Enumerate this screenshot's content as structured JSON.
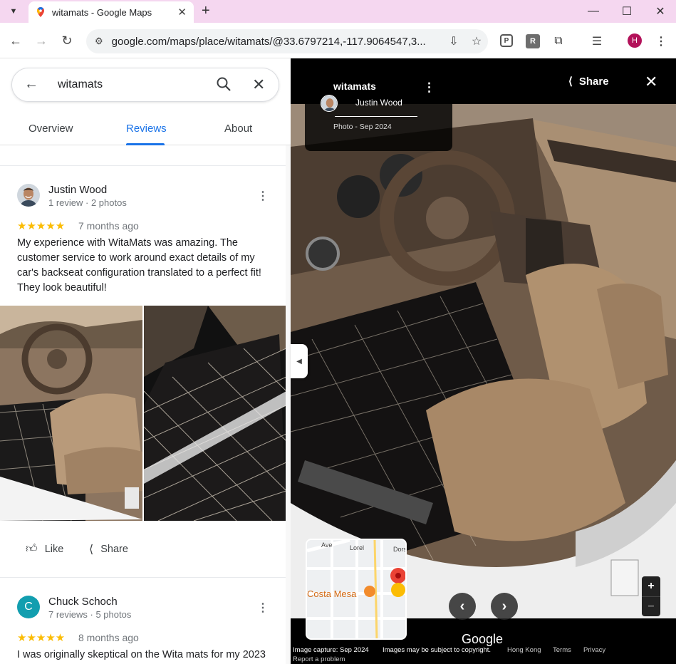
{
  "browser": {
    "tab_title": "witamats - Google Maps",
    "url": "google.com/maps/place/witamats/@33.6797214,-117.9064547,3...",
    "profile_initial": "H",
    "ext_r_label": "R"
  },
  "search": {
    "query": "witamats"
  },
  "place_tabs": {
    "overview": "Overview",
    "reviews": "Reviews",
    "about": "About"
  },
  "reviews": [
    {
      "name": "Justin Wood",
      "meta": "1 review · 2 photos",
      "stars": "★★★★★",
      "rating": 5,
      "date": "7 months ago",
      "text": "My experience with WitaMats was amazing. The customer service to work around exact details of my car's backseat configuration translated to a perfect fit! They look beautiful!",
      "like": "Like",
      "share": "Share"
    },
    {
      "name": "Chuck Schoch",
      "initial": "C",
      "meta": "7 reviews · 5 photos",
      "stars": "★★★★★",
      "rating": 5,
      "date": "8 months ago",
      "text": "I was originally skeptical on the Wita mats for my 2023"
    }
  ],
  "viewer": {
    "title": "witamats",
    "author": "Justin Wood",
    "photo_date": "Photo - Sep 2024",
    "share": "Share",
    "map_labels": {
      "ave": "Ave",
      "lorel": "Lorel",
      "dorset": "Dors",
      "city": "Costa Mesa"
    },
    "logo": "Google",
    "footer": {
      "capture": "Image capture: Sep 2024",
      "copyright": "Images may be subject to copyright.",
      "region": "Hong Kong",
      "terms": "Terms",
      "privacy": "Privacy",
      "report": "Report a problem"
    }
  },
  "colors": {
    "accent": "#1a73e8",
    "star": "#fbbc04",
    "tabbar": "#f5d7f0",
    "avatar_c": "#129eaf",
    "profile": "#b3125a"
  }
}
